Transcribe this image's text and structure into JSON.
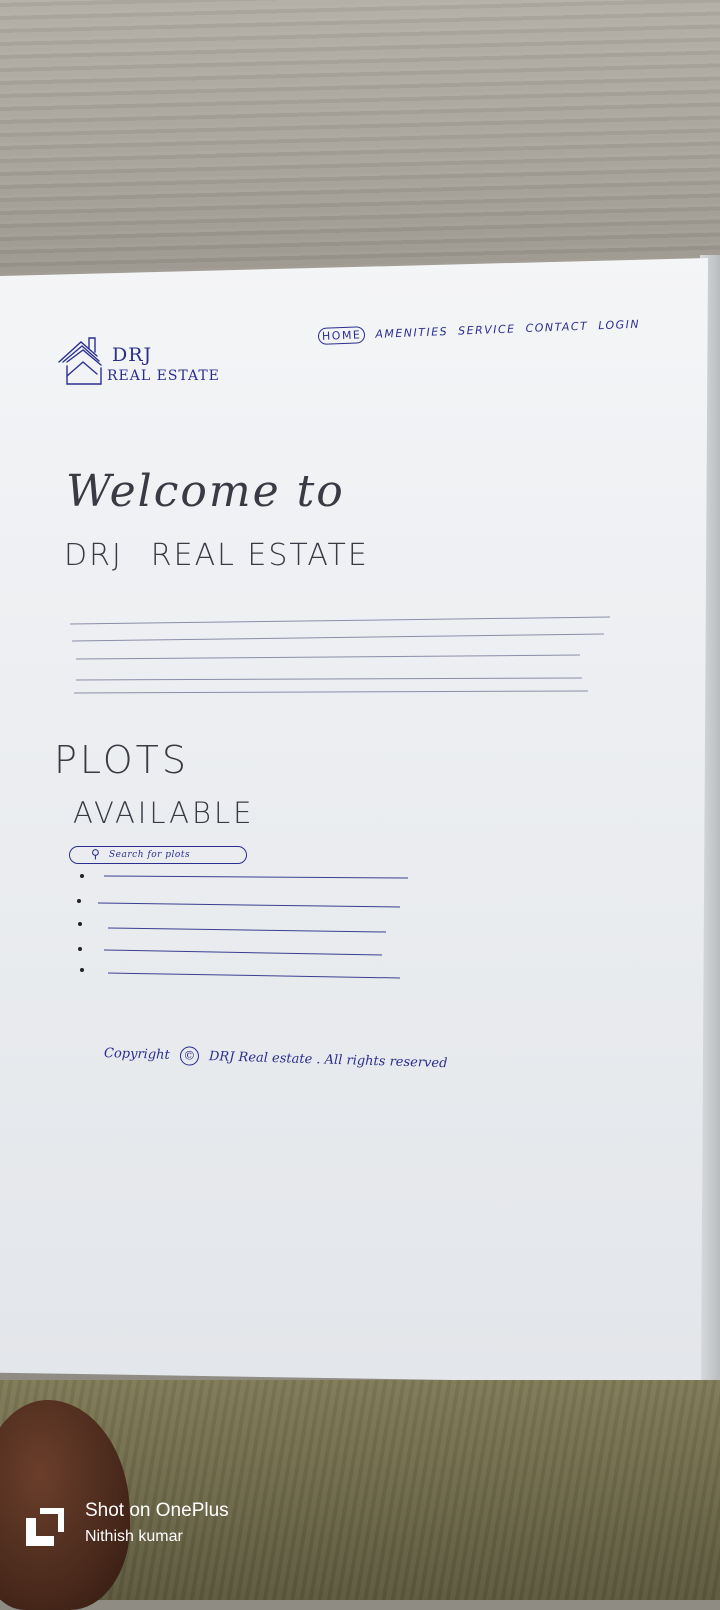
{
  "photo": {
    "desk_color": "#a8a49b",
    "paper_color": "#eceef1",
    "ink_color": "#2a2f8f",
    "pencil_color": "#3a3a44"
  },
  "header": {
    "brand": "DRJ",
    "brand_sub": "REAL ESTATE",
    "logo_icon": "house-icon",
    "nav": [
      "HOME",
      "AMENITIES",
      "SERVICE",
      "CONTACT",
      "LOGIN"
    ]
  },
  "hero": {
    "line1": "Welcome to",
    "line2a": "DRJ",
    "line2b": "REAL ESTATE"
  },
  "plots": {
    "title": "PLOTS",
    "subtitle": "AVAILABLE",
    "search_placeholder": "Search for plots",
    "search_icon": "search-icon"
  },
  "footer": {
    "copyright_prefix": "Copyright",
    "copyright_symbol": "©",
    "copyright_text": "DRJ Real estate . All rights reserved"
  },
  "watermark": {
    "line1": "Shot on OnePlus",
    "line2": "Nithish kumar",
    "icon": "oneplus-logo-icon"
  }
}
